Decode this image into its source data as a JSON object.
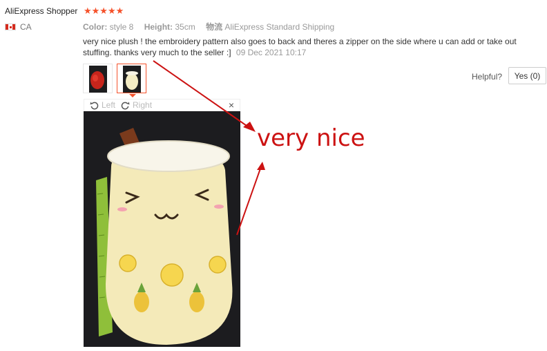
{
  "reviewer": {
    "name": "AliExpress Shopper",
    "stars": "★★★★★",
    "rating": 5,
    "country_code": "CA"
  },
  "meta": {
    "color_label": "Color:",
    "color_value": "style 8",
    "height_label": "Height:",
    "height_value": "35cm",
    "shipping_label": "物流",
    "shipping_value": "AliExpress Standard Shipping"
  },
  "review": {
    "text": "very nice plush ! the embroidery pattern also goes to back and theres a zipper on the side where u can add or take out stuffing. thanks very much to the seller :]",
    "date": "09 Dec 2021 10:17"
  },
  "viewer": {
    "rotate_left_label": "Left",
    "rotate_right_label": "Right",
    "close_symbol": "×"
  },
  "helpful": {
    "label": "Helpful?",
    "yes_label": "Yes (0)"
  },
  "annotation": {
    "text": "very nice",
    "color": "#cc1212"
  },
  "colors": {
    "accent": "#f5512a",
    "annotation": "#cc1212"
  },
  "icons": [
    "flag-canada-icon",
    "rotate-left-icon",
    "rotate-right-icon",
    "close-icon",
    "star-icon"
  ]
}
